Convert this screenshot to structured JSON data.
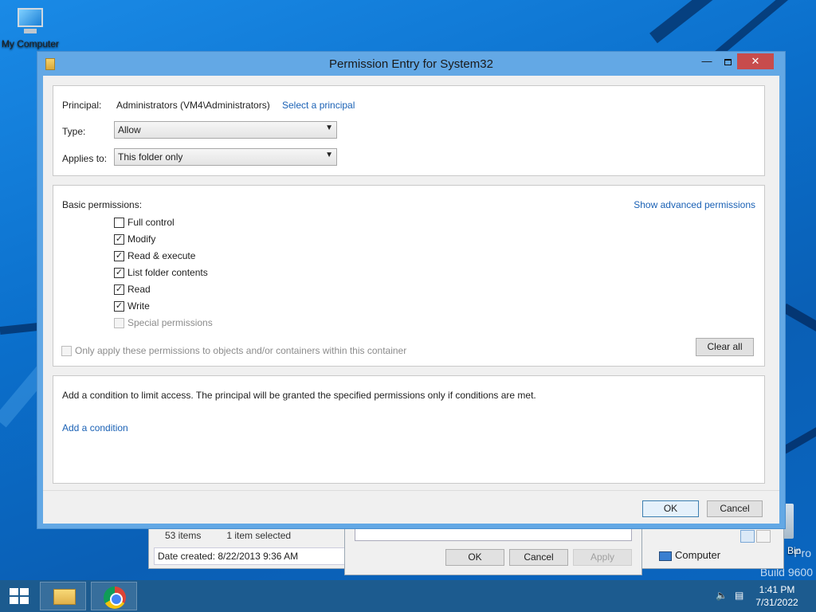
{
  "desktop": {
    "icon_label": "My Computer",
    "bin_label": "Bin",
    "watermark_line1": "Pro",
    "watermark_line2": "Build 9600"
  },
  "explorer": {
    "items_count": "53 items",
    "selected": "1 item selected",
    "date_created": "Date created: 8/22/2013 9:36 AM",
    "location": "Computer"
  },
  "properties_dialog": {
    "ok": "OK",
    "cancel": "Cancel",
    "apply": "Apply"
  },
  "dialog": {
    "title": "Permission Entry for System32",
    "principal_label": "Principal:",
    "principal_value": "Administrators (VM4\\Administrators)",
    "select_principal": "Select a principal",
    "type_label": "Type:",
    "type_value": "Allow",
    "applies_label": "Applies to:",
    "applies_value": "This folder only",
    "basic_label": "Basic permissions:",
    "show_advanced": "Show advanced permissions",
    "permissions": [
      {
        "label": "Full control",
        "checked": false,
        "disabled": false
      },
      {
        "label": "Modify",
        "checked": true,
        "disabled": false
      },
      {
        "label": "Read & execute",
        "checked": true,
        "disabled": false
      },
      {
        "label": "List folder contents",
        "checked": true,
        "disabled": false
      },
      {
        "label": "Read",
        "checked": true,
        "disabled": false
      },
      {
        "label": "Write",
        "checked": true,
        "disabled": false
      },
      {
        "label": "Special permissions",
        "checked": false,
        "disabled": true
      }
    ],
    "only_apply": "Only apply these permissions to objects and/or containers within this container",
    "clear_all": "Clear all",
    "condition_text": "Add a condition to limit access. The principal will be granted the specified permissions only if conditions are met.",
    "add_condition": "Add a condition",
    "ok": "OK",
    "cancel": "Cancel"
  },
  "taskbar": {
    "time": "1:41 PM",
    "date": "7/31/2022"
  }
}
